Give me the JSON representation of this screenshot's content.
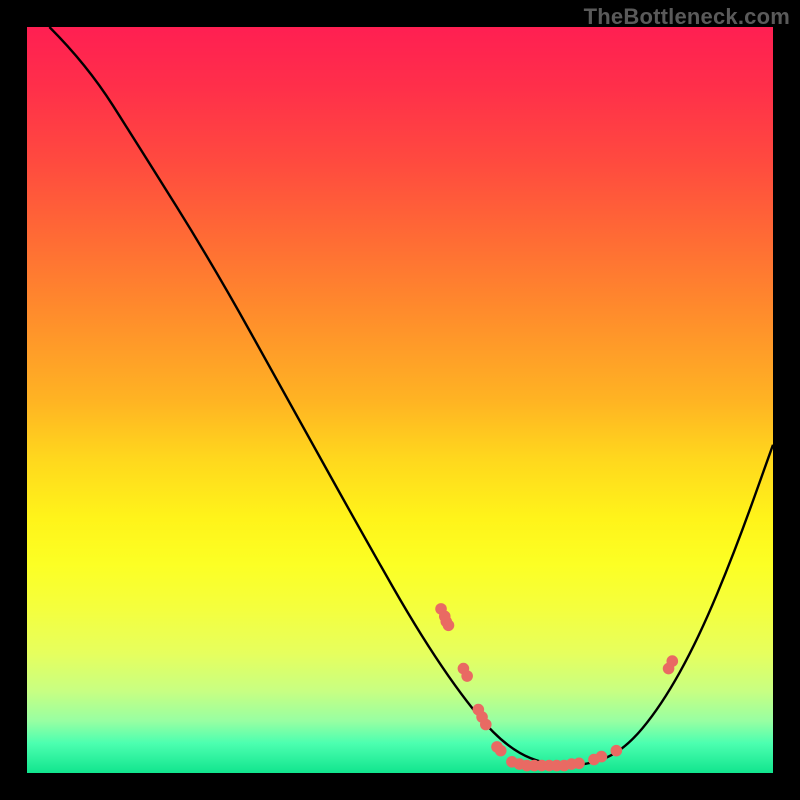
{
  "attribution": "TheBottleneck.com",
  "chart_data": {
    "type": "line",
    "title": "",
    "xlabel": "",
    "ylabel": "",
    "xlim": [
      0,
      100
    ],
    "ylim": [
      0,
      100
    ],
    "curve": [
      {
        "x": 3,
        "y": 100
      },
      {
        "x": 8,
        "y": 95
      },
      {
        "x": 15,
        "y": 84
      },
      {
        "x": 25,
        "y": 68
      },
      {
        "x": 35,
        "y": 50
      },
      {
        "x": 45,
        "y": 32
      },
      {
        "x": 53,
        "y": 18
      },
      {
        "x": 60,
        "y": 8
      },
      {
        "x": 65,
        "y": 3
      },
      {
        "x": 70,
        "y": 1
      },
      {
        "x": 75,
        "y": 1
      },
      {
        "x": 80,
        "y": 3
      },
      {
        "x": 85,
        "y": 9
      },
      {
        "x": 90,
        "y": 18
      },
      {
        "x": 95,
        "y": 30
      },
      {
        "x": 100,
        "y": 44
      }
    ],
    "markers": [
      {
        "x": 55.5,
        "y": 22.0
      },
      {
        "x": 56.0,
        "y": 21.0
      },
      {
        "x": 56.2,
        "y": 20.3
      },
      {
        "x": 56.5,
        "y": 19.8
      },
      {
        "x": 58.5,
        "y": 14.0
      },
      {
        "x": 59.0,
        "y": 13.0
      },
      {
        "x": 60.5,
        "y": 8.5
      },
      {
        "x": 61.0,
        "y": 7.5
      },
      {
        "x": 61.5,
        "y": 6.5
      },
      {
        "x": 63.0,
        "y": 3.5
      },
      {
        "x": 63.5,
        "y": 3.0
      },
      {
        "x": 65.0,
        "y": 1.5
      },
      {
        "x": 66.0,
        "y": 1.2
      },
      {
        "x": 67.0,
        "y": 1.0
      },
      {
        "x": 68.0,
        "y": 1.0
      },
      {
        "x": 69.0,
        "y": 1.0
      },
      {
        "x": 70.0,
        "y": 1.0
      },
      {
        "x": 71.0,
        "y": 1.0
      },
      {
        "x": 72.0,
        "y": 1.0
      },
      {
        "x": 73.0,
        "y": 1.2
      },
      {
        "x": 74.0,
        "y": 1.3
      },
      {
        "x": 76.0,
        "y": 1.8
      },
      {
        "x": 77.0,
        "y": 2.2
      },
      {
        "x": 79.0,
        "y": 3.0
      },
      {
        "x": 86.0,
        "y": 14.0
      },
      {
        "x": 86.5,
        "y": 15.0
      }
    ],
    "marker_color": "#e96a63",
    "curve_color": "#000000"
  }
}
